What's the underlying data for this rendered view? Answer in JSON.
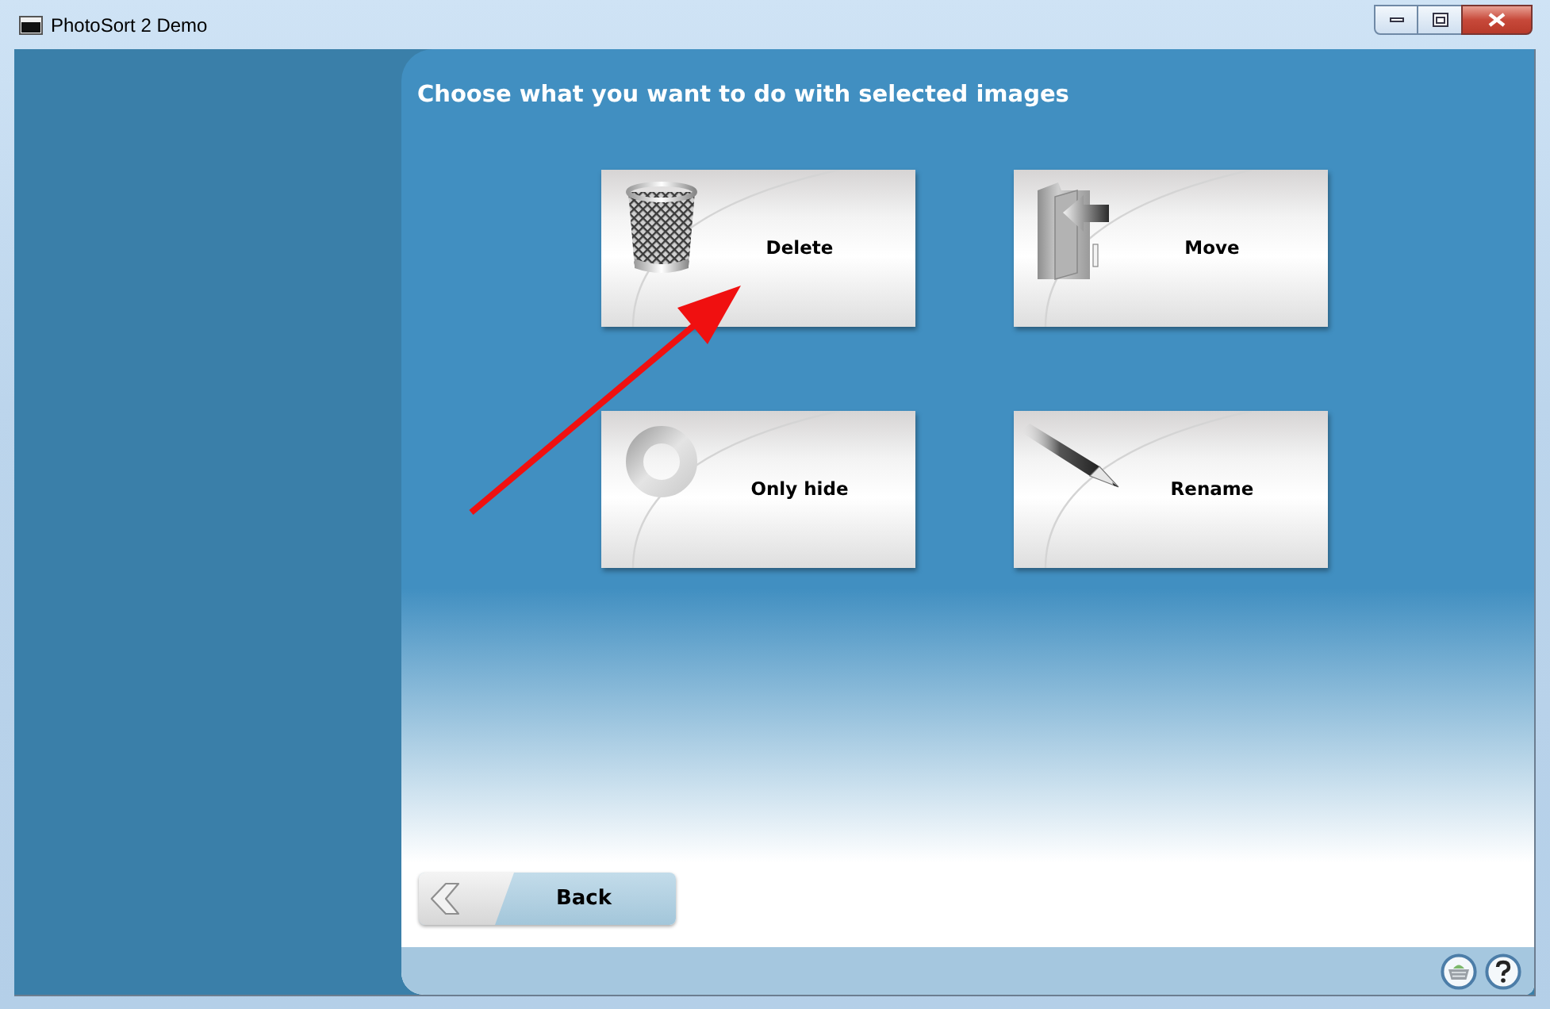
{
  "window": {
    "title": "PhotoSort 2 Demo"
  },
  "heading": "Choose what you want to do with selected images",
  "actions": [
    {
      "kind": "trash",
      "label": "Delete"
    },
    {
      "kind": "folder",
      "label": "Move"
    },
    {
      "kind": "ring",
      "label": "Only hide"
    },
    {
      "kind": "pencil",
      "label": "Rename"
    }
  ],
  "back_button": {
    "label": "Back"
  }
}
